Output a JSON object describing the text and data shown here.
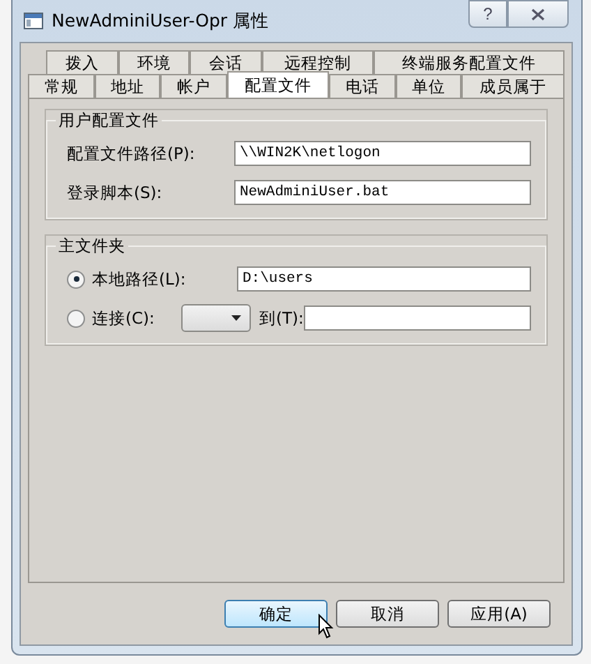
{
  "window": {
    "title": "NewAdminiUser-Opr 属性",
    "help_button": "?"
  },
  "tab_rows": [
    [
      {
        "label": "拨入",
        "selected": false
      },
      {
        "label": "环境",
        "selected": false
      },
      {
        "label": "会话",
        "selected": false
      },
      {
        "label": "远程控制",
        "selected": false
      },
      {
        "label": "终端服务配置文件",
        "selected": false
      }
    ],
    [
      {
        "label": "常规",
        "selected": false
      },
      {
        "label": "地址",
        "selected": false
      },
      {
        "label": "帐户",
        "selected": false
      },
      {
        "label": "配置文件",
        "selected": true
      },
      {
        "label": "电话",
        "selected": false
      },
      {
        "label": "单位",
        "selected": false
      },
      {
        "label": "成员属于",
        "selected": false
      }
    ]
  ],
  "user_profile": {
    "title": "用户配置文件",
    "fields": [
      {
        "label": "配置文件路径(P):",
        "value": "\\\\WIN2K\\netlogon"
      },
      {
        "label": "登录脚本(S):",
        "value": "NewAdminiUser.bat"
      }
    ]
  },
  "home_folder": {
    "title": "主文件夹",
    "options": [
      {
        "kind": "path",
        "label": "本地路径(L):",
        "selected": true,
        "value": "D:\\users"
      },
      {
        "kind": "connect",
        "label": "连接(C):",
        "selected": false,
        "to_label": "到(T):"
      }
    ]
  },
  "buttons": [
    {
      "label": "确定",
      "default": true
    },
    {
      "label": "取消",
      "default": false
    },
    {
      "label": "应用(A)",
      "default": false
    }
  ]
}
